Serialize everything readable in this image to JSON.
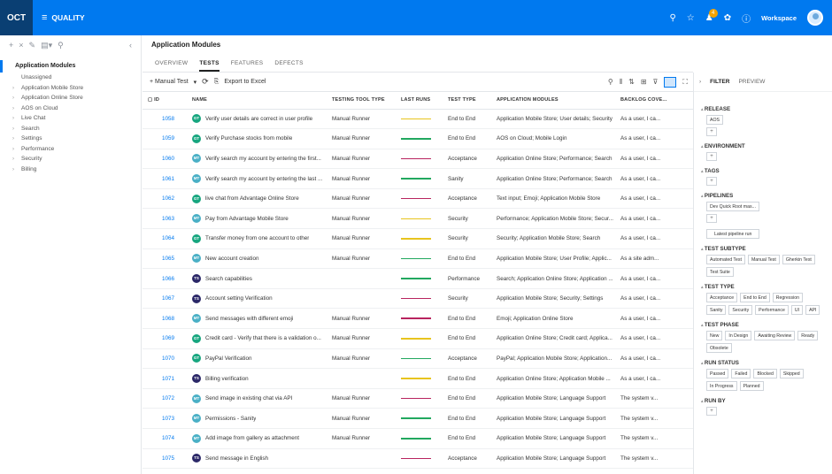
{
  "topbar": {
    "logo": "OCT",
    "module": "QUALITY",
    "workspace": "Workspace",
    "notification_count": "4",
    "icons": [
      "search-icon",
      "star-icon",
      "notification-icon",
      "settings-icon",
      "help-icon"
    ]
  },
  "left_panel": {
    "root": "Application Modules",
    "items": [
      {
        "label": "Unassigned",
        "expandable": false
      },
      {
        "label": "Application Mobile Store",
        "expandable": true
      },
      {
        "label": "Application Online Store",
        "expandable": true
      },
      {
        "label": "AOS on Cloud",
        "expandable": true
      },
      {
        "label": "Live Chat",
        "expandable": true
      },
      {
        "label": "Search",
        "expandable": true
      },
      {
        "label": "Settings",
        "expandable": true
      },
      {
        "label": "Performance",
        "expandable": true
      },
      {
        "label": "Security",
        "expandable": true
      },
      {
        "label": "Billing",
        "expandable": true
      }
    ]
  },
  "main": {
    "title": "Application Modules",
    "tabs": [
      "OVERVIEW",
      "TESTS",
      "FEATURES",
      "DEFECTS"
    ],
    "active_tab": "TESTS",
    "toolbar": {
      "new_label": "+ Manual Test",
      "export_label": "Export to Excel"
    },
    "columns": [
      "ID",
      "NAME",
      "TESTING TOOL TYPE",
      "LAST RUNS",
      "TEST TYPE",
      "APPLICATION MODULES",
      "BACKLOG COVE..."
    ],
    "rows": [
      {
        "id": "1058",
        "icon": "GT",
        "name": "Verify user details are correct in user profile",
        "tool": "Manual Runner",
        "run": "#e8c41e",
        "type": "End to End",
        "modules": "Application Mobile Store; User details; Security",
        "backlog": "As a user, I ca..."
      },
      {
        "id": "1059",
        "icon": "GT",
        "name": "Verify Purchase stocks from mobile",
        "tool": "Manual Runner",
        "run": "#22a85f",
        "type": "End to End",
        "modules": "AOS on Cloud; Mobile Login",
        "backlog": "As a user, I ca..."
      },
      {
        "id": "1060",
        "icon": "MT",
        "name": "Verify search my account by entering the first...",
        "tool": "Manual Runner",
        "run": "#b8245f",
        "type": "Acceptance",
        "modules": "Application Online Store; Performance; Search",
        "backlog": "As a user, I ca..."
      },
      {
        "id": "1061",
        "icon": "MT",
        "name": "Verify search my account by entering the last ...",
        "tool": "Manual Runner",
        "run": "#22a85f",
        "type": "Sanity",
        "modules": "Application Online Store; Performance; Search",
        "backlog": "As a user, I ca..."
      },
      {
        "id": "1062",
        "icon": "GT",
        "name": "live chat from Advantage Online Store",
        "tool": "Manual Runner",
        "run": "#b8245f",
        "type": "Acceptance",
        "modules": "Text input; Emoji; Application Mobile Store",
        "backlog": "As a user, I ca..."
      },
      {
        "id": "1063",
        "icon": "MT",
        "name": "Pay from Advantage Mobile Store",
        "tool": "Manual Runner",
        "run": "#e8c41e",
        "type": "Security",
        "modules": "Performance; Application Mobile Store; Secur...",
        "backlog": "As a user, I ca..."
      },
      {
        "id": "1064",
        "icon": "GT",
        "name": "Transfer money from one account to other",
        "tool": "Manual Runner",
        "run": "#e8c41e",
        "type": "Security",
        "modules": "Security; Application Mobile Store; Search",
        "backlog": "As a user, I ca..."
      },
      {
        "id": "1065",
        "icon": "MT",
        "name": "New account creation",
        "tool": "Manual Runner",
        "run": "#22a85f",
        "type": "End to End",
        "modules": "Application Mobile Store; User Profile; Applic...",
        "backlog": "As a site adm..."
      },
      {
        "id": "1066",
        "icon": "TS",
        "name": "Search capabilities",
        "tool": "",
        "run": "#22a85f",
        "type": "Performance",
        "modules": "Search; Application Online Store; Application ...",
        "backlog": "As a user, I ca..."
      },
      {
        "id": "1067",
        "icon": "TS",
        "name": "Account setting Verification",
        "tool": "",
        "run": "#b8245f",
        "type": "Security",
        "modules": "Application Mobile Store; Security; Settings",
        "backlog": "As a user, I ca..."
      },
      {
        "id": "1068",
        "icon": "MT",
        "name": "Send messages with different emoji",
        "tool": "Manual Runner",
        "run": "#b8245f",
        "type": "End to End",
        "modules": "Emoji; Application Online Store",
        "backlog": "As a user, I ca..."
      },
      {
        "id": "1069",
        "icon": "GT",
        "name": "Credit card - Verify that there is a validation o...",
        "tool": "Manual Runner",
        "run": "#e8c41e",
        "type": "End to End",
        "modules": "Application Online Store; Credit card; Applica...",
        "backlog": "As a user, I ca..."
      },
      {
        "id": "1070",
        "icon": "GT",
        "name": "PayPal Verification",
        "tool": "Manual Runner",
        "run": "#22a85f",
        "type": "Acceptance",
        "modules": "PayPal; Application Mobile Store; Application...",
        "backlog": "As a user, I ca..."
      },
      {
        "id": "1071",
        "icon": "TS",
        "name": "Billing verification",
        "tool": "",
        "run": "#e8c41e",
        "type": "End to End",
        "modules": "Application Online Store; Application Mobile ...",
        "backlog": "As a user, I ca..."
      },
      {
        "id": "1072",
        "icon": "MT",
        "name": "Send image in existing chat via API",
        "tool": "Manual Runner",
        "run": "#b8245f",
        "type": "End to End",
        "modules": "Application Mobile Store; Language Support",
        "backlog": "The system v..."
      },
      {
        "id": "1073",
        "icon": "MT",
        "name": "Permissions - Sanity",
        "tool": "Manual Runner",
        "run": "#22a85f",
        "type": "End to End",
        "modules": "Application Mobile Store; Language Support",
        "backlog": "The system v..."
      },
      {
        "id": "1074",
        "icon": "MT",
        "name": "Add image from gallery as attachment",
        "tool": "Manual Runner",
        "run": "#22a85f",
        "type": "End to End",
        "modules": "Application Mobile Store; Language Support",
        "backlog": "The system v..."
      },
      {
        "id": "1075",
        "icon": "TS",
        "name": "Send message in English",
        "tool": "",
        "run": "#b8245f",
        "type": "Acceptance",
        "modules": "Application Mobile Store; Language Support",
        "backlog": "The system v..."
      }
    ]
  },
  "filter_panel": {
    "tabs": [
      "FILTER",
      "PREVIEW"
    ],
    "groups": [
      {
        "title": "RELEASE",
        "chips": [
          "AOS"
        ],
        "add": true
      },
      {
        "title": "ENVIRONMENT",
        "chips": [],
        "add": true
      },
      {
        "title": "TAGS",
        "chips": [],
        "add": true
      },
      {
        "title": "PIPELINES",
        "chips": [
          "Dev Quick Root mas..."
        ],
        "add": true,
        "extra": [
          "Latest pipeline run"
        ]
      },
      {
        "title": "TEST SUBTYPE",
        "chips": [
          "Automated Test",
          "Manual Test",
          "Gherkin Test",
          "Test Suite"
        ],
        "add": false
      },
      {
        "title": "TEST TYPE",
        "chips": [
          "Acceptance",
          "End to End",
          "Regression",
          "Sanity",
          "Security",
          "Performance",
          "UI",
          "API"
        ],
        "add": false
      },
      {
        "title": "TEST PHASE",
        "chips": [
          "New",
          "In Design",
          "Awaiting Review",
          "Ready",
          "Obsolete"
        ],
        "add": false
      },
      {
        "title": "RUN STATUS",
        "chips": [
          "Passed",
          "Failed",
          "Blocked",
          "Skipped",
          "In Progress",
          "Planned"
        ],
        "add": false
      },
      {
        "title": "RUN BY",
        "chips": [],
        "add": true
      }
    ]
  }
}
